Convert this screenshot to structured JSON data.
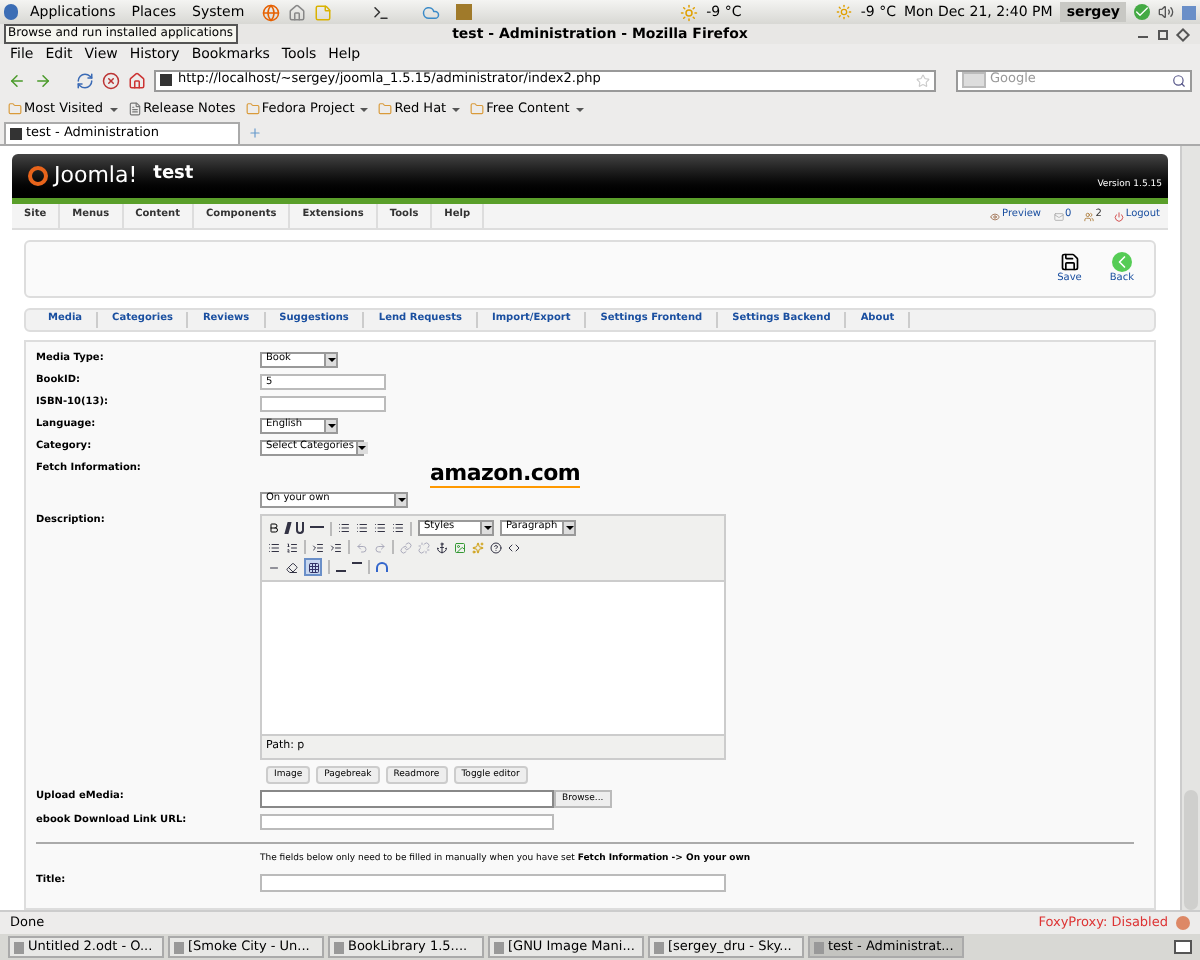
{
  "top_panel": {
    "menus": [
      "Applications",
      "Places",
      "System"
    ],
    "weather": "-9 °C",
    "weather_right": "-9 °C",
    "clock": "Mon Dec 21,  2:40 PM",
    "user": "sergey"
  },
  "tooltip": "Browse and run installed applications",
  "window": {
    "title": "test - Administration - Mozilla Firefox"
  },
  "menu": [
    "File",
    "Edit",
    "View",
    "History",
    "Bookmarks",
    "Tools",
    "Help"
  ],
  "address": {
    "url": "http://localhost/~sergey/joomla_1.5.15/administrator/index2.php"
  },
  "search": {
    "placeholder": "Google"
  },
  "bookmarks": [
    {
      "label": "Most Visited",
      "kind": "folder"
    },
    {
      "label": "Release Notes",
      "kind": "page"
    },
    {
      "label": "Fedora Project",
      "kind": "folder"
    },
    {
      "label": "Red Hat",
      "kind": "folder"
    },
    {
      "label": "Free Content",
      "kind": "folder"
    }
  ],
  "tabs": [
    {
      "label": "test - Administration",
      "selected": true
    }
  ],
  "joomla": {
    "logo": "Joomla!",
    "site": "test",
    "version": "Version 1.5.15",
    "menu": [
      "Site",
      "Menus",
      "Content",
      "Components",
      "Extensions",
      "Tools",
      "Help"
    ],
    "status": {
      "preview": "Preview",
      "messages": "0",
      "users": "2",
      "logout": "Logout"
    },
    "toolbar": [
      {
        "label": "Save",
        "kind": "save"
      },
      {
        "label": "Back",
        "kind": "back"
      }
    ],
    "submenu": [
      "Media",
      "Categories",
      "Reviews",
      "Suggestions",
      "Lend Requests",
      "Import/Export",
      "Settings Frontend",
      "Settings Backend",
      "About"
    ]
  },
  "form": {
    "fields": [
      {
        "kind": "select",
        "label": "Media Type:",
        "value": "Book"
      },
      {
        "kind": "text",
        "label": "BookID:",
        "value": "5"
      },
      {
        "kind": "text",
        "label": "ISBN-10(13):"
      },
      {
        "kind": "select",
        "label": "Language:",
        "value": "English"
      },
      {
        "kind": "select",
        "label": "Category:",
        "value": "Select Categories"
      },
      {
        "kind": "fetch",
        "label": "Fetch Information:",
        "logo": "amazon.com",
        "value": "On your own"
      },
      {
        "kind": "editor",
        "label": "Description:",
        "styles": "Styles",
        "format": "Paragraph",
        "path": "Path: p",
        "buttons": [
          "Image",
          "Pagebreak",
          "Readmore",
          "Toggle editor"
        ]
      },
      {
        "kind": "file",
        "label": "Upload eMedia:",
        "button": "Browse..."
      },
      {
        "kind": "text",
        "label": "ebook Download Link URL:"
      }
    ],
    "note": "The fields below only need to be filled in manually when you have set **Fetch Information -> On your own**",
    "title_label": "Title:"
  },
  "status_bar": {
    "text": "Done",
    "proxy": "FoxyProxy: Disabled"
  },
  "taskbar": [
    {
      "label": "Untitled 2.odt - O...",
      "selected": false
    },
    {
      "label": "[Smoke City - Un...",
      "selected": false
    },
    {
      "label": "BookLibrary 1.5....",
      "selected": false
    },
    {
      "label": "[GNU Image Mani...",
      "selected": false
    },
    {
      "label": "[sergey_dru - Sky...",
      "selected": false
    },
    {
      "label": "test - Administrat...",
      "selected": true
    }
  ]
}
